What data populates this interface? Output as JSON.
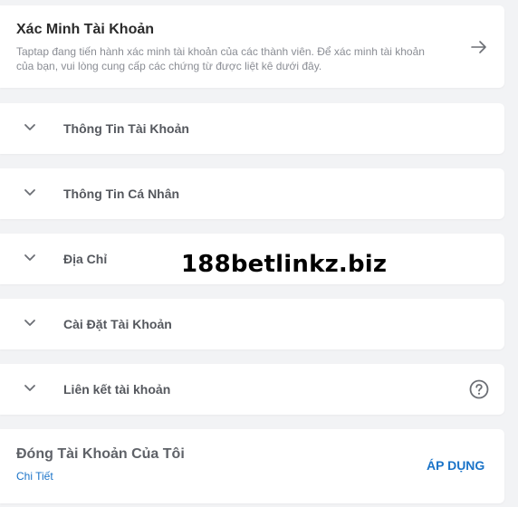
{
  "verification": {
    "title": "Xác Minh Tài Khoản",
    "description": "Taptap đang tiến hành xác minh tài khoản của các thành viên. Để xác minh tài khoản của bạn, vui lòng cung cấp các chứng từ được liệt kê dưới đây.",
    "icon": "arrow-right-icon"
  },
  "sections": [
    {
      "label": "Thông Tin Tài Khoản"
    },
    {
      "label": "Thông Tin Cá Nhân"
    },
    {
      "label": "Địa Chỉ"
    },
    {
      "label": "Cài Đặt Tài Khoản"
    },
    {
      "label": "Liên kết tài khoản",
      "icon": "help-icon"
    }
  ],
  "close_account": {
    "title": "Đóng Tài Khoản Của Tôi",
    "detail_link": "Chi Tiết",
    "apply_label": "ÁP DỤNG"
  },
  "watermark": "188betlinkz.biz",
  "colors": {
    "accent": "#1a73c8",
    "background": "#f2f3f5",
    "card": "#ffffff"
  }
}
